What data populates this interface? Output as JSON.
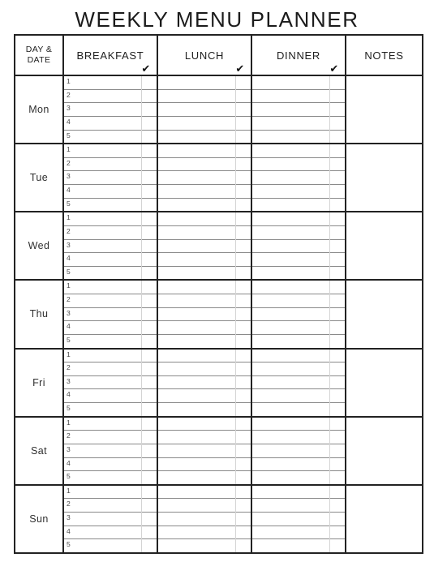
{
  "title": "WEEKLY MENU PLANNER",
  "header": {
    "day_date": "DAY &\nDATE",
    "breakfast": "BREAKFAST",
    "lunch": "LUNCH",
    "dinner": "DINNER",
    "notes": "NOTES",
    "check_glyph": "✔"
  },
  "line_numbers": [
    "1",
    "2",
    "3",
    "4",
    "5"
  ],
  "days": [
    {
      "label": "Mon"
    },
    {
      "label": "Tue"
    },
    {
      "label": "Wed"
    },
    {
      "label": "Thu"
    },
    {
      "label": "Fri"
    },
    {
      "label": "Sat"
    },
    {
      "label": "Sun"
    }
  ],
  "colors": {
    "border_dark": "#222222",
    "rule_gray": "#8a8a8a",
    "tick_divider": "#d4d4d4",
    "text": "#1a1a1a",
    "page_background": "#ffffff"
  }
}
